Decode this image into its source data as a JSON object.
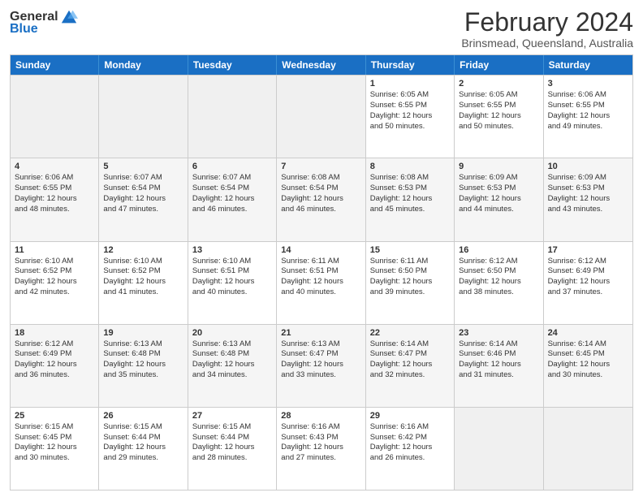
{
  "header": {
    "logo_general": "General",
    "logo_blue": "Blue",
    "title": "February 2024",
    "subtitle": "Brinsmead, Queensland, Australia"
  },
  "days_of_week": [
    "Sunday",
    "Monday",
    "Tuesday",
    "Wednesday",
    "Thursday",
    "Friday",
    "Saturday"
  ],
  "weeks": [
    [
      {
        "day": "",
        "info": ""
      },
      {
        "day": "",
        "info": ""
      },
      {
        "day": "",
        "info": ""
      },
      {
        "day": "",
        "info": ""
      },
      {
        "day": "1",
        "info": "Sunrise: 6:05 AM\nSunset: 6:55 PM\nDaylight: 12 hours\nand 50 minutes."
      },
      {
        "day": "2",
        "info": "Sunrise: 6:05 AM\nSunset: 6:55 PM\nDaylight: 12 hours\nand 50 minutes."
      },
      {
        "day": "3",
        "info": "Sunrise: 6:06 AM\nSunset: 6:55 PM\nDaylight: 12 hours\nand 49 minutes."
      }
    ],
    [
      {
        "day": "4",
        "info": "Sunrise: 6:06 AM\nSunset: 6:55 PM\nDaylight: 12 hours\nand 48 minutes."
      },
      {
        "day": "5",
        "info": "Sunrise: 6:07 AM\nSunset: 6:54 PM\nDaylight: 12 hours\nand 47 minutes."
      },
      {
        "day": "6",
        "info": "Sunrise: 6:07 AM\nSunset: 6:54 PM\nDaylight: 12 hours\nand 46 minutes."
      },
      {
        "day": "7",
        "info": "Sunrise: 6:08 AM\nSunset: 6:54 PM\nDaylight: 12 hours\nand 46 minutes."
      },
      {
        "day": "8",
        "info": "Sunrise: 6:08 AM\nSunset: 6:53 PM\nDaylight: 12 hours\nand 45 minutes."
      },
      {
        "day": "9",
        "info": "Sunrise: 6:09 AM\nSunset: 6:53 PM\nDaylight: 12 hours\nand 44 minutes."
      },
      {
        "day": "10",
        "info": "Sunrise: 6:09 AM\nSunset: 6:53 PM\nDaylight: 12 hours\nand 43 minutes."
      }
    ],
    [
      {
        "day": "11",
        "info": "Sunrise: 6:10 AM\nSunset: 6:52 PM\nDaylight: 12 hours\nand 42 minutes."
      },
      {
        "day": "12",
        "info": "Sunrise: 6:10 AM\nSunset: 6:52 PM\nDaylight: 12 hours\nand 41 minutes."
      },
      {
        "day": "13",
        "info": "Sunrise: 6:10 AM\nSunset: 6:51 PM\nDaylight: 12 hours\nand 40 minutes."
      },
      {
        "day": "14",
        "info": "Sunrise: 6:11 AM\nSunset: 6:51 PM\nDaylight: 12 hours\nand 40 minutes."
      },
      {
        "day": "15",
        "info": "Sunrise: 6:11 AM\nSunset: 6:50 PM\nDaylight: 12 hours\nand 39 minutes."
      },
      {
        "day": "16",
        "info": "Sunrise: 6:12 AM\nSunset: 6:50 PM\nDaylight: 12 hours\nand 38 minutes."
      },
      {
        "day": "17",
        "info": "Sunrise: 6:12 AM\nSunset: 6:49 PM\nDaylight: 12 hours\nand 37 minutes."
      }
    ],
    [
      {
        "day": "18",
        "info": "Sunrise: 6:12 AM\nSunset: 6:49 PM\nDaylight: 12 hours\nand 36 minutes."
      },
      {
        "day": "19",
        "info": "Sunrise: 6:13 AM\nSunset: 6:48 PM\nDaylight: 12 hours\nand 35 minutes."
      },
      {
        "day": "20",
        "info": "Sunrise: 6:13 AM\nSunset: 6:48 PM\nDaylight: 12 hours\nand 34 minutes."
      },
      {
        "day": "21",
        "info": "Sunrise: 6:13 AM\nSunset: 6:47 PM\nDaylight: 12 hours\nand 33 minutes."
      },
      {
        "day": "22",
        "info": "Sunrise: 6:14 AM\nSunset: 6:47 PM\nDaylight: 12 hours\nand 32 minutes."
      },
      {
        "day": "23",
        "info": "Sunrise: 6:14 AM\nSunset: 6:46 PM\nDaylight: 12 hours\nand 31 minutes."
      },
      {
        "day": "24",
        "info": "Sunrise: 6:14 AM\nSunset: 6:45 PM\nDaylight: 12 hours\nand 30 minutes."
      }
    ],
    [
      {
        "day": "25",
        "info": "Sunrise: 6:15 AM\nSunset: 6:45 PM\nDaylight: 12 hours\nand 30 minutes."
      },
      {
        "day": "26",
        "info": "Sunrise: 6:15 AM\nSunset: 6:44 PM\nDaylight: 12 hours\nand 29 minutes."
      },
      {
        "day": "27",
        "info": "Sunrise: 6:15 AM\nSunset: 6:44 PM\nDaylight: 12 hours\nand 28 minutes."
      },
      {
        "day": "28",
        "info": "Sunrise: 6:16 AM\nSunset: 6:43 PM\nDaylight: 12 hours\nand 27 minutes."
      },
      {
        "day": "29",
        "info": "Sunrise: 6:16 AM\nSunset: 6:42 PM\nDaylight: 12 hours\nand 26 minutes."
      },
      {
        "day": "",
        "info": ""
      },
      {
        "day": "",
        "info": ""
      }
    ]
  ]
}
